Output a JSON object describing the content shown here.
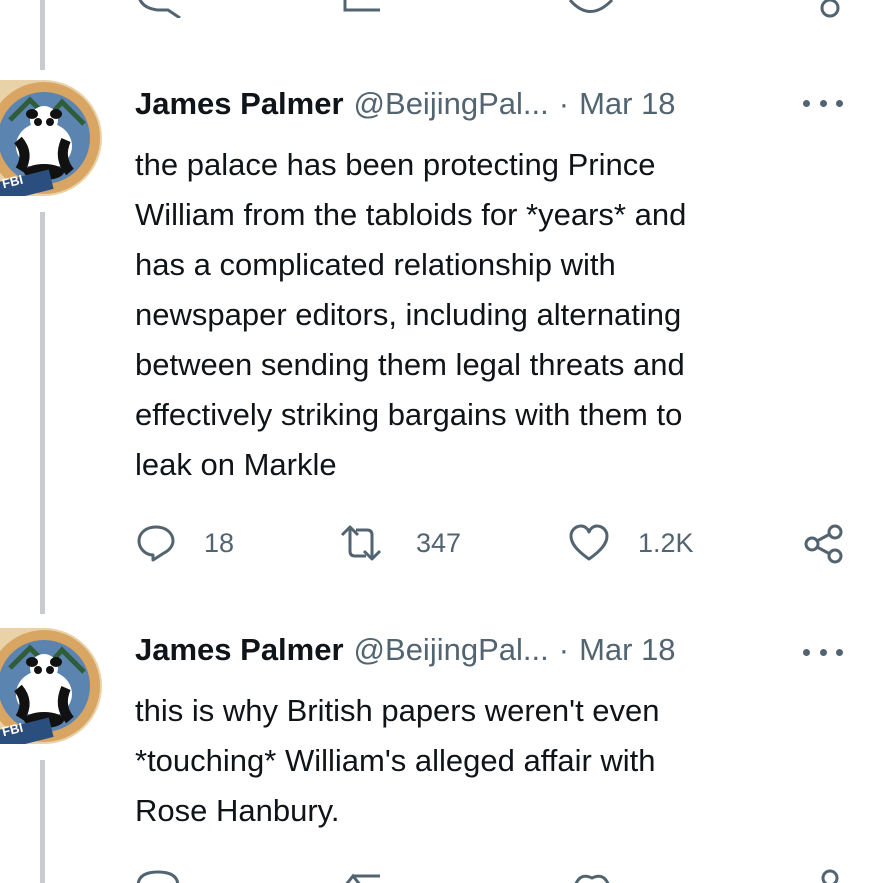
{
  "tweets": [
    {
      "name": "James Palmer",
      "handle": "@BeijingPal...",
      "separator": "·",
      "date": "Mar 18",
      "lines": [
        "the palace has been protecting Prince",
        "William from the tabloids for *years* and",
        "has a complicated relationship with",
        "newspaper editors, including alternating",
        "between sending them legal threats and",
        "effectively striking bargains with them to",
        "leak on Markle"
      ],
      "replies": "18",
      "retweets": "347",
      "likes": "1.2K",
      "avatar_text": "FBI"
    },
    {
      "name": "James Palmer",
      "handle": "@BeijingPal...",
      "separator": "·",
      "date": "Mar 18",
      "lines": [
        "this is why British papers weren't even",
        "*touching* William's alleged affair with",
        "Rose Hanbury."
      ],
      "avatar_text": "FBI"
    }
  ],
  "icons": {
    "reply": "reply-icon",
    "retweet": "retweet-icon",
    "like": "heart-icon",
    "share": "share-icon",
    "more": "more-icon"
  },
  "colors": {
    "text": "#0f1419",
    "secondary": "#536471",
    "thread_line": "#c8ccd0"
  }
}
